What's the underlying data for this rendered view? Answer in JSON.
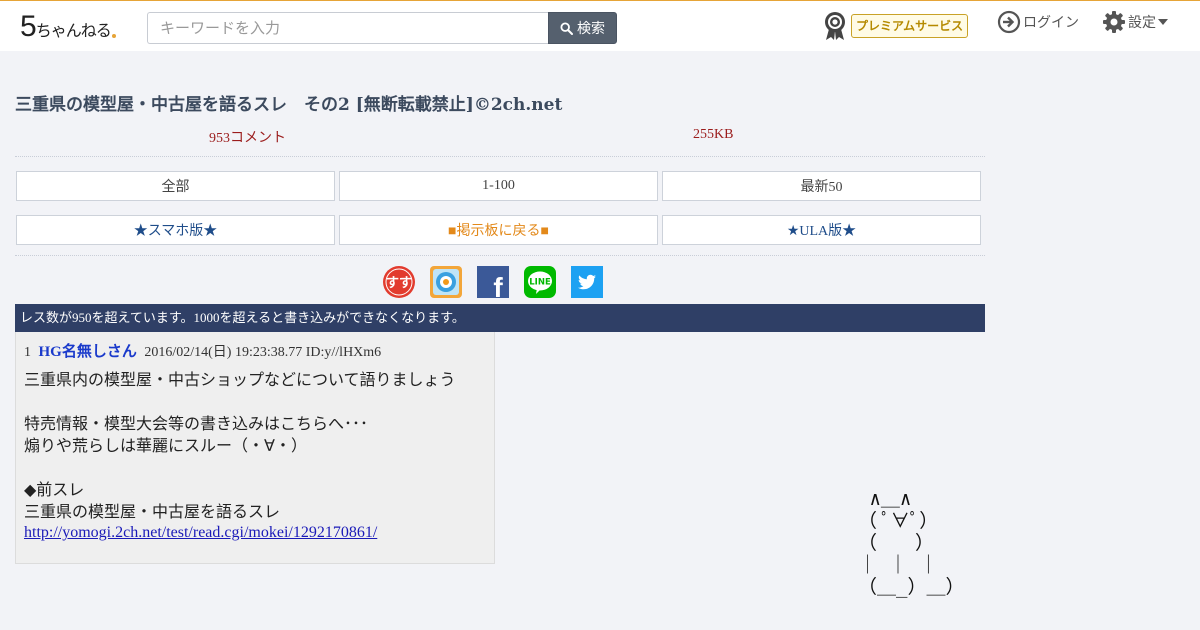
{
  "header": {
    "logo_text": "5ちゃんねる",
    "logo_five": "5",
    "logo_rest": "ちゃんねる",
    "search": {
      "placeholder": "キーワードを入力",
      "button_label": "検索"
    },
    "premium_label": "プレミアムサービス",
    "login_label": "ログイン",
    "settings_label": "設定"
  },
  "thread": {
    "title": "三重県の模型屋・中古屋を語るスレ　その2 [無断転載禁止]©2ch.net",
    "comment_count": "953コメント",
    "size": "255KB"
  },
  "nav": {
    "row1": [
      "全部",
      "1-100",
      "最新50"
    ],
    "row2": [
      "★スマホ版★",
      "■掲示板に戻る■",
      "★ULA版★"
    ]
  },
  "share_icons": [
    "sussu-icon",
    "dope-icon",
    "facebook-icon",
    "line-icon",
    "twitter-icon"
  ],
  "share_texts": {
    "sussu": "すす",
    "facebook": "f",
    "line": "LINE"
  },
  "notice": "レス数が950を超えています。1000を超えると書き込みができなくなります。",
  "post": {
    "number": "1",
    "name": "HG名無しさん",
    "date": "2016/02/14(日) 19:23:38.77",
    "id": "ID:y//lHXm6",
    "lines": [
      "三重県内の模型屋・中古ショップなどについて語りましょう",
      "",
      "特売情報・模型大会等の書き込みはこちらへ･･･",
      "煽りや荒らしは華麗にスルー（・∀・）",
      "",
      "◆前スレ",
      "三重県の模型屋・中古屋を語るスレ"
    ],
    "link": "http://yomogi.2ch.net/test/read.cgi/mokei/1292170861/"
  },
  "ascii_art": " ∧＿∧\n（ ﾟ∀ﾟ）\n（　　）\n｜ ｜ ｜\n（＿_）＿）",
  "colors": {
    "header_border": "#e6a437",
    "notice_bg": "#2f3f66",
    "meta_red": "#9b1c1c",
    "name_blue": "#1a3acb",
    "premium_gold": "#b58a00"
  }
}
